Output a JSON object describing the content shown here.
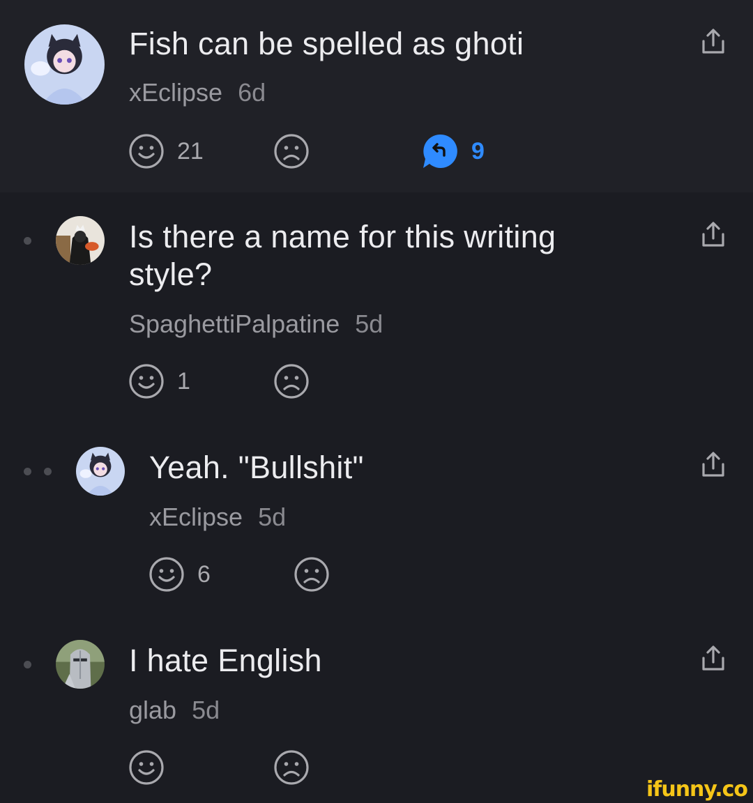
{
  "comments": [
    {
      "text": "Fish can be spelled as ghoti",
      "user": "xEclipse",
      "age": "6d",
      "likes": "21",
      "replies": "9"
    },
    {
      "text": "Is there a name for this writing style?",
      "user": "SpaghettiPalpatine",
      "age": "5d",
      "likes": "1"
    },
    {
      "text": "Yeah. \"Bullshit\"",
      "user": "xEclipse",
      "age": "5d",
      "likes": "6"
    },
    {
      "text": "I hate English",
      "user": "glab",
      "age": "5d",
      "likes": ""
    }
  ],
  "watermark": "ifunny.co",
  "colors": {
    "background": "#1b1c22",
    "highlight": "#202127",
    "reply_blue": "#2f8bff",
    "watermark": "#f5c518"
  },
  "icons": [
    "smile-icon",
    "frown-icon",
    "share-icon",
    "reply-bubble-icon"
  ]
}
